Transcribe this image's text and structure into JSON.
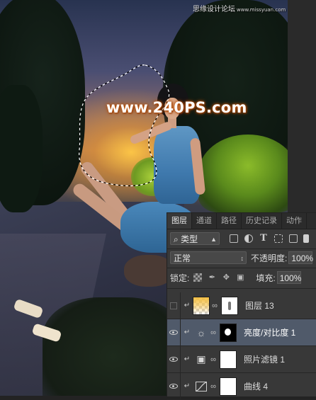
{
  "watermark": {
    "top_text": "思缘设计论坛",
    "top_url": "www.missyuan.com",
    "center_text": "www.240PS.com"
  },
  "layers_panel": {
    "tabs": [
      {
        "label": "图层",
        "active": true
      },
      {
        "label": "通道",
        "active": false
      },
      {
        "label": "路径",
        "active": false
      },
      {
        "label": "历史记录",
        "active": false
      },
      {
        "label": "动作",
        "active": false
      }
    ],
    "filter": {
      "search_glyph": "⌕",
      "kind_label": "类型",
      "icons": [
        "image-filter-icon",
        "adjustment-filter-icon",
        "text-filter-icon",
        "shape-filter-icon",
        "smart-object-filter-icon"
      ]
    },
    "blend_mode": "正常",
    "opacity_label": "不透明度:",
    "opacity_value": "100%",
    "lock_label": "锁定:",
    "fill_label": "填充:",
    "fill_value": "100%",
    "layers": [
      {
        "name": "图层 13",
        "visible": false,
        "selected": false,
        "kind": "pixel",
        "thumb": "checker-orange",
        "mask": "white-streak"
      },
      {
        "name": "亮度/对比度 1",
        "visible": true,
        "selected": true,
        "kind": "adjustment",
        "icon": "brightness-icon",
        "mask": "black-white-spot"
      },
      {
        "name": "照片滤镜 1",
        "visible": true,
        "selected": false,
        "kind": "adjustment",
        "icon": "photo-filter-icon",
        "mask": "white"
      },
      {
        "name": "曲线 4",
        "visible": true,
        "selected": false,
        "kind": "adjustment",
        "icon": "curves-icon",
        "mask": "white"
      }
    ]
  },
  "colors": {
    "panel_bg": "#383838",
    "selected_row": "#505a6a",
    "glow": "#ffc846"
  }
}
